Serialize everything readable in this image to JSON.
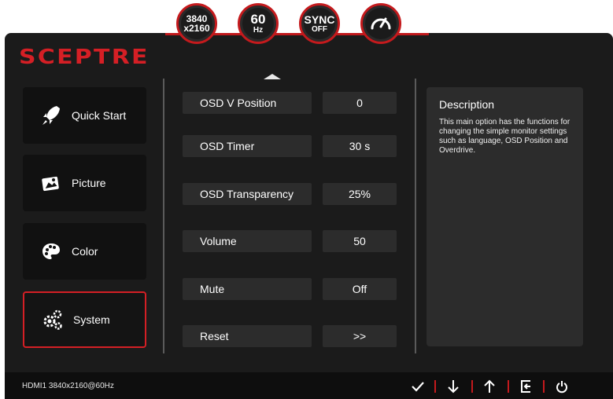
{
  "status_badges": {
    "resolution": {
      "line1": "3840",
      "line2": "x2160"
    },
    "refresh": {
      "line1": "60",
      "line2": "Hz"
    },
    "sync": {
      "line1": "SYNC",
      "line2": "OFF"
    }
  },
  "brand": {
    "logo": "SCEPTRE"
  },
  "sidebar": {
    "items": [
      {
        "label": "Quick Start",
        "icon": "rocket-icon"
      },
      {
        "label": "Picture",
        "icon": "picture-icon"
      },
      {
        "label": "Color",
        "icon": "palette-icon"
      },
      {
        "label": "System",
        "icon": "gears-icon",
        "active": true
      }
    ]
  },
  "settings": {
    "rows": [
      {
        "label": "OSD V Position",
        "value": "0"
      },
      {
        "label": "OSD Timer",
        "value": "30 s"
      },
      {
        "label": "OSD Transparency",
        "value": "25%"
      },
      {
        "label": "Volume",
        "value": "50"
      },
      {
        "label": "Mute",
        "value": "Off"
      },
      {
        "label": "Reset",
        "value": ">>"
      }
    ]
  },
  "description": {
    "title": "Description",
    "text": "This main option has the functions for changing the simple monitor settings such as  language, OSD Position and Overdrive."
  },
  "footer": {
    "input_info": "HDMI1 3840x2160@60Hz",
    "buttons": [
      "check-icon",
      "arrow-down-icon",
      "arrow-up-icon",
      "exit-icon",
      "power-icon"
    ]
  },
  "colors": {
    "accent": "#d51f25",
    "panel": "#1b1b1b",
    "tile": "#2c2c2c"
  }
}
